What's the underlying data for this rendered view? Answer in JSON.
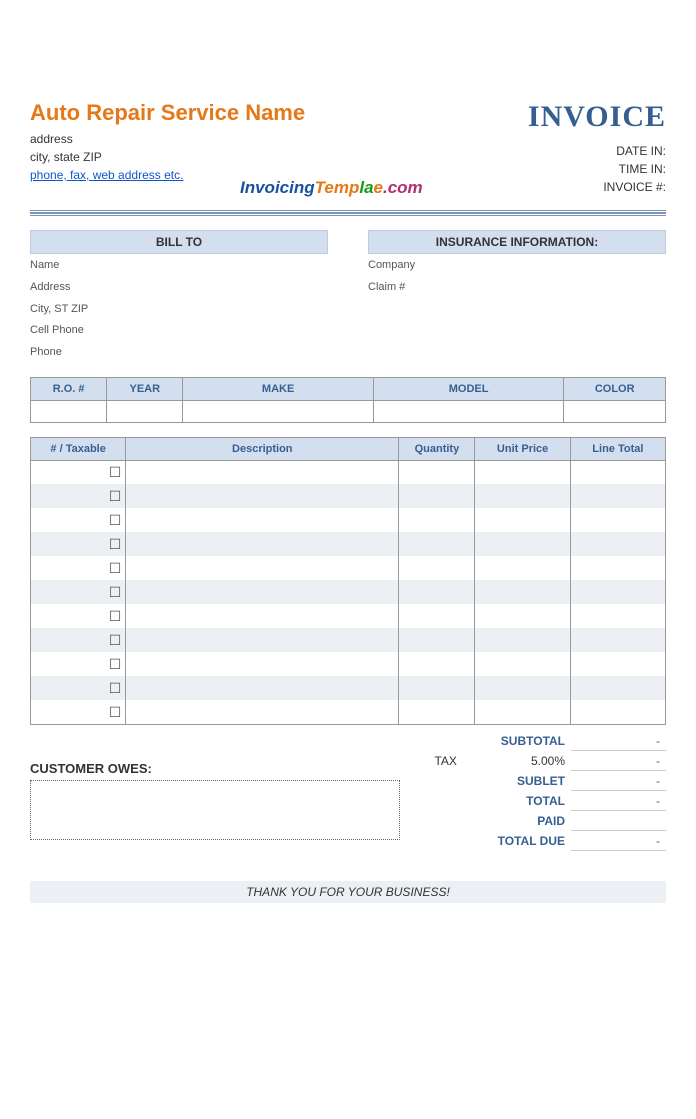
{
  "company": {
    "name": "Auto Repair Service Name",
    "address": "address",
    "city_state_zip": "city, state ZIP",
    "contact": "phone, fax, web address etc."
  },
  "invoice_word": "INVOICE",
  "meta": {
    "date_in_label": "DATE IN:",
    "time_in_label": "TIME IN:",
    "invoice_no_label": "INVOICE #:"
  },
  "watermark": {
    "p1": "Invoicing",
    "p2": "Temp",
    "p3": "la",
    "p4": "e",
    "p5": ".com"
  },
  "sections": {
    "bill_to": "BILL TO",
    "insurance": "INSURANCE INFORMATION:"
  },
  "bill_fields": [
    "Name",
    "Address",
    "City, ST ZIP",
    "Cell Phone",
    "Phone"
  ],
  "ins_fields": [
    "Company",
    "Claim #"
  ],
  "vehicle_headers": [
    "R.O. #",
    "YEAR",
    "MAKE",
    "MODEL",
    "COLOR"
  ],
  "item_headers": [
    "# / Taxable",
    "Description",
    "Quantity",
    "Unit Price",
    "Line Total"
  ],
  "item_rows": 11,
  "owes_label": "CUSTOMER OWES:",
  "totals": {
    "subtotal": "SUBTOTAL",
    "tax": "TAX",
    "tax_rate": "5.00%",
    "sublet": "SUBLET",
    "total": "TOTAL",
    "paid": "PAID",
    "total_due": "TOTAL DUE",
    "dash": "-"
  },
  "footer": "THANK YOU FOR YOUR BUSINESS!"
}
